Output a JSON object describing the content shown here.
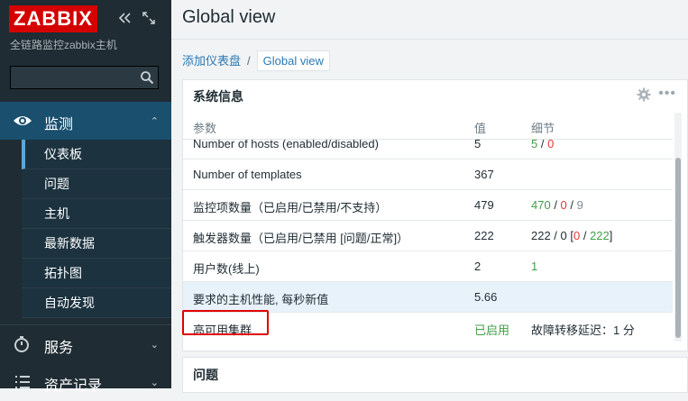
{
  "sidebar": {
    "logo": "ZABBIX",
    "subtitle": "全链路监控zabbix主机",
    "search_value": "",
    "monitoring_label": "监测",
    "submenu": [
      "仪表板",
      "问题",
      "主机",
      "最新数据",
      "拓扑图",
      "自动发现"
    ],
    "services_label": "服务",
    "assets_label": "资产记录"
  },
  "header": {
    "title": "Global view"
  },
  "breadcrumb": {
    "parent": "添加仪表盘",
    "separator": "/",
    "current": "Global view"
  },
  "system_info": {
    "title": "系统信息",
    "columns": [
      "参数",
      "值",
      "细节"
    ],
    "rows": [
      {
        "param": "Number of hosts (enabled/disabled)",
        "value": "5",
        "details": [
          "5",
          " / ",
          "0"
        ]
      },
      {
        "param": "Number of templates",
        "value": "367",
        "details": []
      },
      {
        "param": "监控项数量（已启用/已禁用/不支持）",
        "value": "479",
        "details": [
          "470",
          " / ",
          "0",
          " / ",
          "9"
        ]
      },
      {
        "param": "触发器数量（已启用/已禁用 [问题/正常]）",
        "value": "222",
        "details": [
          "222 / 0 [",
          "0",
          " / ",
          "222",
          "]"
        ]
      },
      {
        "param": "用户数(线上)",
        "value": "2",
        "details": [
          "1"
        ]
      },
      {
        "param": "要求的主机性能, 每秒新值",
        "value": "5.66",
        "details": []
      },
      {
        "param": "高可用集群",
        "value": "已启用",
        "details": [
          "故障转移延迟：1 分"
        ]
      }
    ]
  },
  "problems": {
    "title": "问题"
  },
  "colors": {
    "sidebar_bg": "#1f2c33",
    "active_menu_bg": "#1a4f6e",
    "logo_red": "#d40000",
    "green": "#429e47",
    "red": "#e33734",
    "link_blue": "#2a79b4"
  }
}
